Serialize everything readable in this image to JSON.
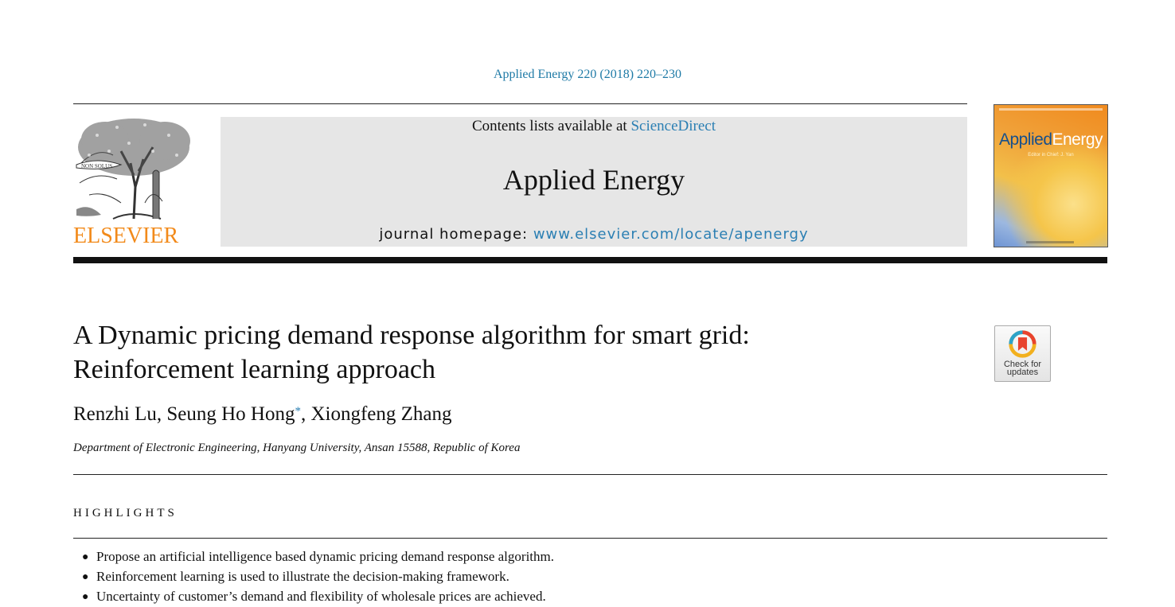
{
  "header": {
    "citation": "Applied Energy 220 (2018) 220–230",
    "contents_prefix": "Contents lists available at ",
    "contents_link": "ScienceDirect",
    "journal_title": "Applied Energy",
    "homepage_prefix": "journal homepage: ",
    "homepage_url": "www.elsevier.com/locate/apenergy",
    "publisher_logo": "ELSEVIER",
    "logo_banner_text": "NON SOLUS",
    "cover_title_main": "Applied",
    "cover_title_accent": "Energy",
    "cover_subtitle": "Editor in Chief: J. Yan"
  },
  "check_updates": {
    "line1": "Check for",
    "line2": "updates",
    "icon": "bookmark-ring-icon"
  },
  "article": {
    "title_line1": "A Dynamic pricing demand response algorithm for smart grid:",
    "title_line2": "Reinforcement learning approach",
    "authors_part1": "Renzhi Lu, Seung Ho Hong",
    "author_mark": "*",
    "authors_part2": ", Xiongfeng Zhang",
    "affiliation": "Department of Electronic Engineering, Hanyang University, Ansan 15588, Republic of Korea"
  },
  "highlights": {
    "heading": "HIGHLIGHTS",
    "items": [
      "Propose an artificial intelligence based dynamic pricing demand response algorithm.",
      "Reinforcement learning is used to illustrate the decision-making framework.",
      "Uncertainty of customer’s demand and flexibility of wholesale prices are achieved."
    ]
  },
  "colors": {
    "link": "#2b7fb3",
    "citation": "#1e7aa6",
    "elsevier_orange": "#f28a1a",
    "banner_gray": "#e6e6e6"
  }
}
